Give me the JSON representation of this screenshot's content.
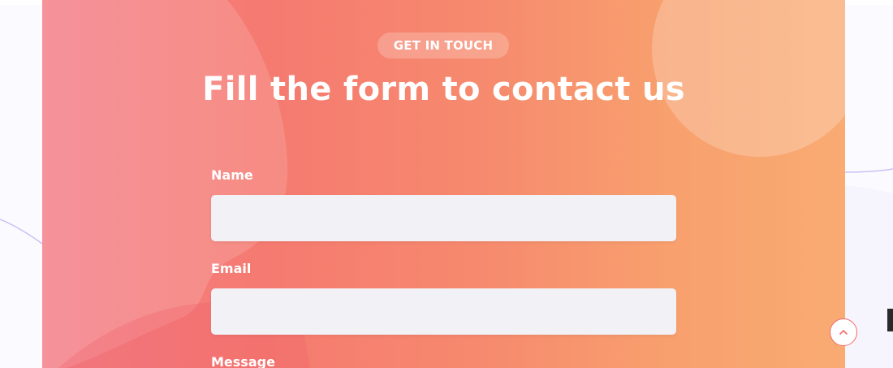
{
  "contact": {
    "eyebrow": "GET IN TOUCH",
    "title": "Fill the form to contact us"
  },
  "form": {
    "name_label": "Name",
    "name_value": "",
    "email_label": "Email",
    "email_value": "",
    "message_label": "Message"
  },
  "scroll_top": {
    "icon": "chevron-up-icon"
  },
  "colors": {
    "gradient_start": "#f4808a",
    "gradient_end": "#f9ab72",
    "input_bg": "#f1f1f6",
    "accent": "#f26a6a"
  }
}
